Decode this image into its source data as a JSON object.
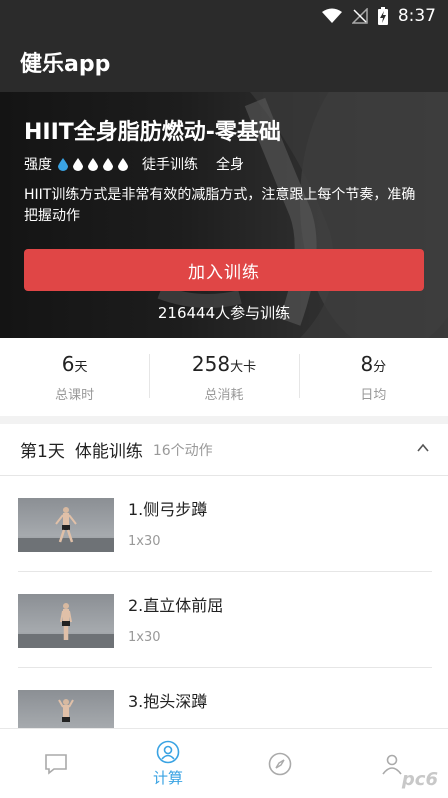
{
  "status_bar": {
    "time": "8:37"
  },
  "app_bar": {
    "title": "健乐app"
  },
  "hero": {
    "title": "HIIT全身脂肪燃动-零基础",
    "intensity_label": "强度",
    "intensity_level": 1,
    "intensity_max": 5,
    "equipment": "徒手训练",
    "body_part": "全身",
    "description": "HIIT训练方式是非常有效的减脂方式，注意跟上每个节奏，准确把握动作",
    "join_button": "加入训练",
    "participants": "216444人参与训练",
    "accent_color": "#e04646",
    "drop_active_color": "#3aa3e3"
  },
  "stats": [
    {
      "value": "6",
      "unit": "天",
      "label": "总课时"
    },
    {
      "value": "258",
      "unit": "大卡",
      "label": "总消耗"
    },
    {
      "value": "8",
      "unit": "分",
      "label": "日均"
    }
  ],
  "section": {
    "day": "第1天",
    "type": "体能训练",
    "count": "16个动作"
  },
  "exercises": [
    {
      "name": "1.侧弓步蹲",
      "reps": "1x30"
    },
    {
      "name": "2.直立体前屈",
      "reps": "1x30"
    },
    {
      "name": "3.抱头深蹲",
      "reps": ""
    }
  ],
  "bottom_nav": [
    {
      "icon": "message-icon",
      "label": ""
    },
    {
      "icon": "user-icon",
      "label": "计算",
      "active": true
    },
    {
      "icon": "compass-icon",
      "label": ""
    },
    {
      "icon": "profile-icon",
      "label": ""
    }
  ],
  "watermark": "pc6"
}
